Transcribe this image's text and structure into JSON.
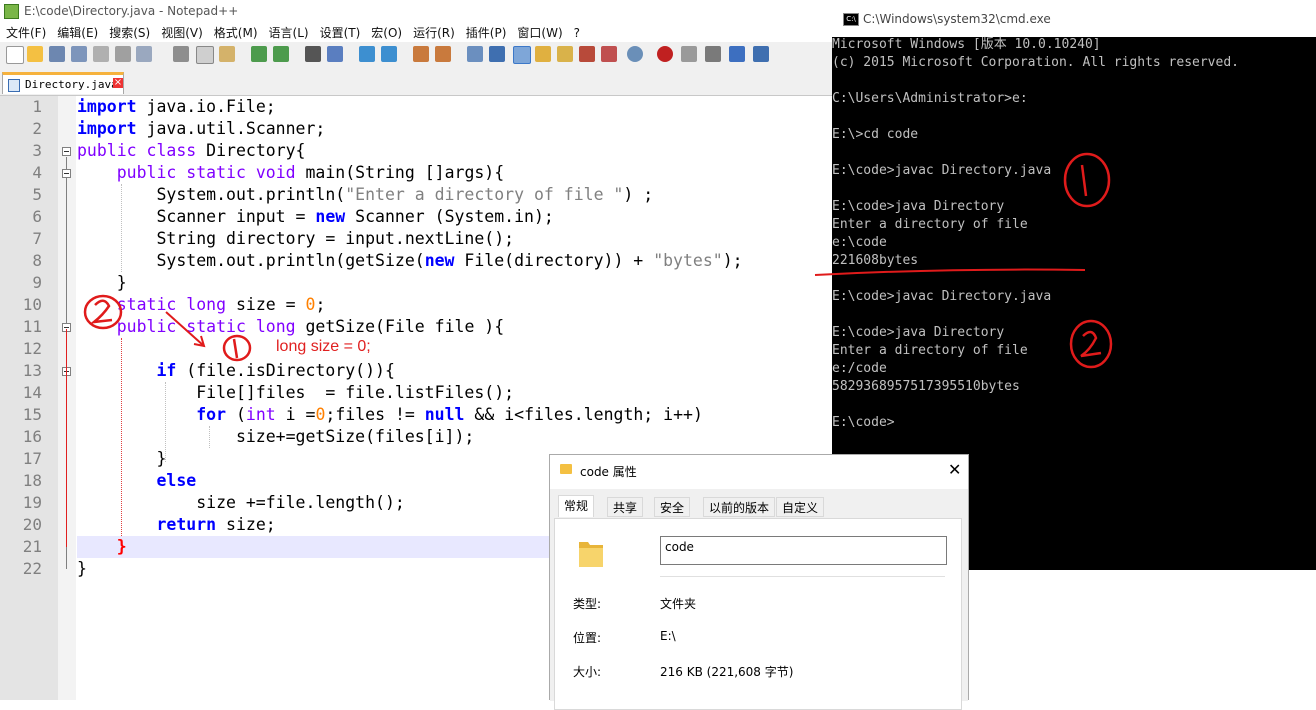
{
  "notepad": {
    "title": "E:\\code\\Directory.java - Notepad++",
    "menu": [
      "文件(F)",
      "编辑(E)",
      "搜索(S)",
      "视图(V)",
      "格式(M)",
      "语言(L)",
      "设置(T)",
      "宏(O)",
      "运行(R)",
      "插件(P)",
      "窗口(W)",
      "?"
    ],
    "tab_label": "Directory.java",
    "line_numbers": [
      "1",
      "2",
      "3",
      "4",
      "5",
      "6",
      "7",
      "8",
      "9",
      "10",
      "11",
      "12",
      "13",
      "14",
      "15",
      "16",
      "17",
      "18",
      "19",
      "20",
      "21",
      "22"
    ],
    "code": {
      "l1_kw": "import",
      "l1_rest": " java.io.File;",
      "l2_kw": "import",
      "l2_rest": " java.util.Scanner;",
      "l3_kw": "public class",
      "l3_rest": " Directory{",
      "l4_indent": "    ",
      "l4_kw": "public static void",
      "l4_rest": " main(String []args){",
      "l5_a": "        System.out.println(",
      "l5_str": "\"Enter a directory of file \"",
      "l5_b": ") ;",
      "l6_a": "        Scanner input = ",
      "l6_kw": "new",
      "l6_b": " Scanner (System.in);",
      "l7": "        String directory = input.nextLine();",
      "l8_a": "        System.out.println(getSize(",
      "l8_kw": "new",
      "l8_b": " File(directory)) + ",
      "l8_str": "\"bytes\"",
      "l8_c": ");",
      "l9": "    }",
      "l10_indent": "    ",
      "l10_kw": "static long",
      "l10_a": " size = ",
      "l10_num": "0",
      "l10_b": ";",
      "l11_indent": "    ",
      "l11_kw": "public static long",
      "l11_a": " getSize(File file ){",
      "l13_indent": "        ",
      "l13_kw": "if",
      "l13_rest": " (file.isDirectory()){",
      "l14": "            File[]files  = file.listFiles();",
      "l15_indent": "            ",
      "l15_kw": "for",
      "l15_a": " (",
      "l15_kw2": "int",
      "l15_b": " i =",
      "l15_num": "0",
      "l15_c": ";files != ",
      "l15_kw3": "null",
      "l15_d": " && i<files.length; i++)",
      "l16": "                size+=getSize(files[i]);",
      "l17": "        }",
      "l18_indent": "        ",
      "l18_kw": "else",
      "l19": "            size +=file.length();",
      "l20_indent": "        ",
      "l20_kw": "return",
      "l20_rest": " size;",
      "l21": "    }",
      "l22": "}"
    }
  },
  "annotation": {
    "note": "long size = 0;"
  },
  "cmd": {
    "title": "C:\\Windows\\system32\\cmd.exe",
    "lines": [
      "Microsoft Windows [版本 10.0.10240]",
      "(c) 2015 Microsoft Corporation. All rights reserved.",
      "",
      "C:\\Users\\Administrator>e:",
      "",
      "E:\\>cd code",
      "",
      "E:\\code>javac Directory.java",
      "",
      "E:\\code>java Directory",
      "Enter a directory of file",
      "e:\\code",
      "221608bytes",
      "",
      "E:\\code>javac Directory.java",
      "",
      "E:\\code>java Directory",
      "Enter a directory of file",
      "e:/code",
      "5829368957517395510bytes",
      "",
      "E:\\code>"
    ]
  },
  "dialog": {
    "title": "code 属性",
    "tabs": [
      "常规",
      "共享",
      "安全",
      "以前的版本",
      "自定义"
    ],
    "name_value": "code",
    "type_label": "类型:",
    "type_value": "文件夹",
    "location_label": "位置:",
    "location_value": "E:\\",
    "size_label": "大小:",
    "size_value": "216 KB (221,608 字节)"
  },
  "colors": {
    "keyword": "#0000ff",
    "type_keyword": "#8000ff",
    "string": "#808080",
    "number": "#ff8000",
    "annotation": "#e02020",
    "current_line": "#e8e8ff"
  }
}
